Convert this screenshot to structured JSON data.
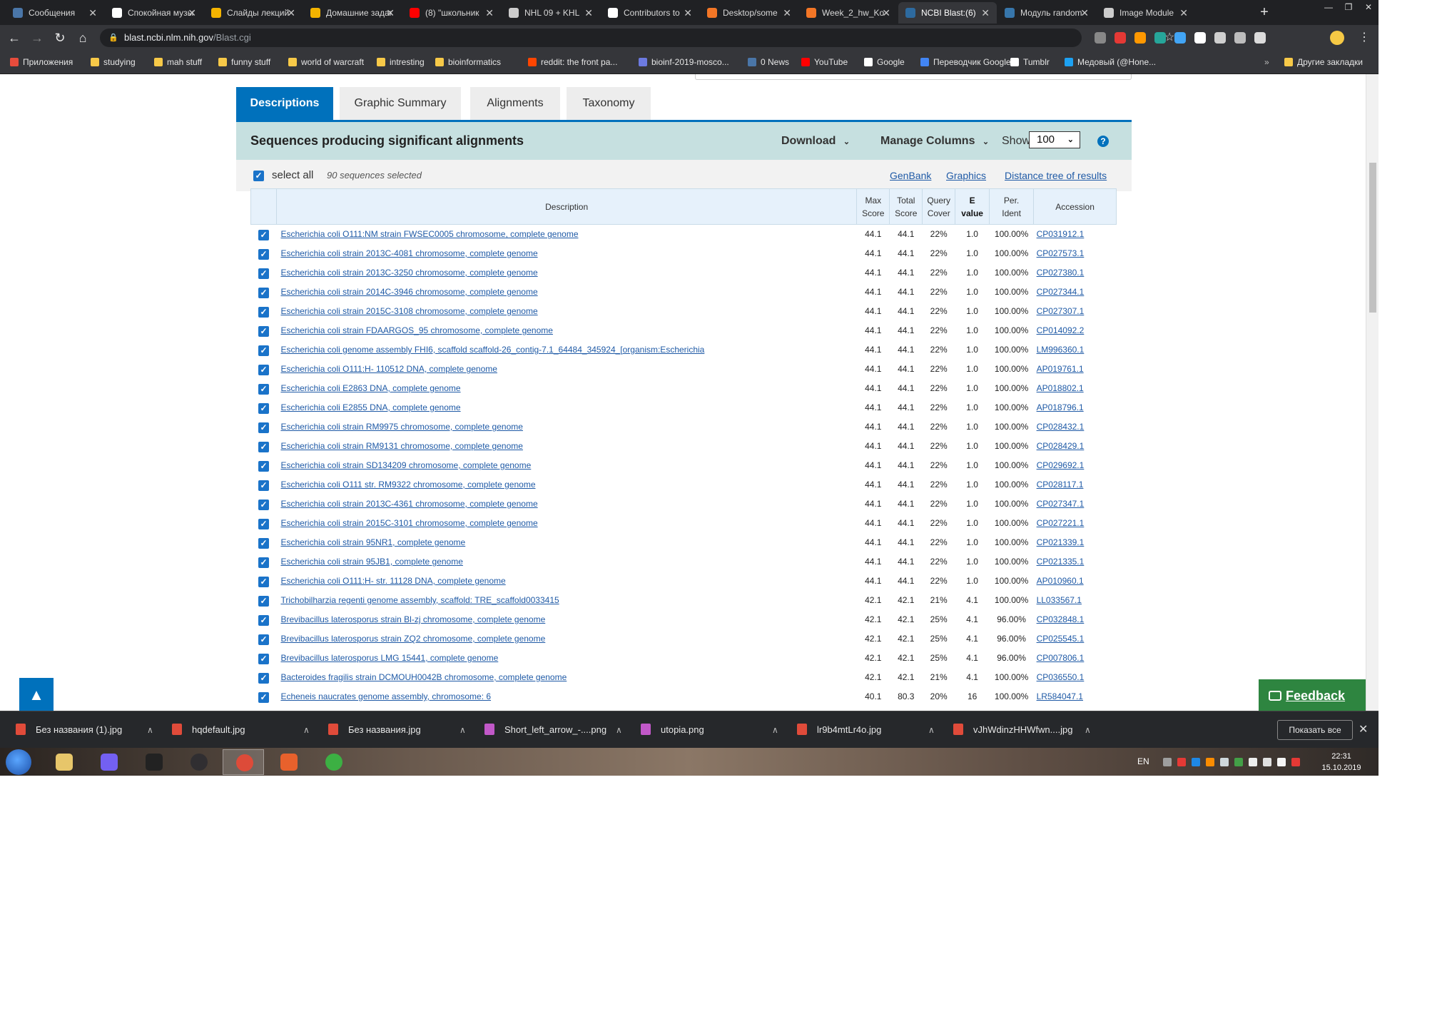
{
  "browser": {
    "tabs": [
      {
        "title": "Сообщения",
        "color": "#4a76a8"
      },
      {
        "title": "Спокойная музыка",
        "color": "#ffffff"
      },
      {
        "title": "Слайды лекций",
        "color": "#f4b400"
      },
      {
        "title": "Домашние задания",
        "color": "#f4b400"
      },
      {
        "title": "(8) \"школьник",
        "color": "#ff0000"
      },
      {
        "title": "NHL 09 + KHL",
        "color": "#cccccc"
      },
      {
        "title": "Contributors to",
        "color": "#ffffff"
      },
      {
        "title": "Desktop/some",
        "color": "#f37626"
      },
      {
        "title": "Week_2_hw_Ko",
        "color": "#f37626"
      },
      {
        "title": "NCBI Blast:(6)",
        "color": "#2d6a9f"
      },
      {
        "title": "Модуль random",
        "color": "#3776ab"
      },
      {
        "title": "Image Module",
        "color": "#cccccc"
      }
    ],
    "active_tab_index": 9,
    "url_host": "blast.ncbi.nlm.nih.gov",
    "url_path": "/Blast.cgi",
    "bookmarks": [
      {
        "label": "Приложения",
        "color": "#e74c3c"
      },
      {
        "label": "studying",
        "color": "#f7c948"
      },
      {
        "label": "mah stuff",
        "color": "#f7c948"
      },
      {
        "label": "funny stuff",
        "color": "#f7c948"
      },
      {
        "label": "world of warcraft",
        "color": "#f7c948"
      },
      {
        "label": "intresting",
        "color": "#f7c948"
      },
      {
        "label": "bioinformatics",
        "color": "#f7c948"
      },
      {
        "label": "reddit: the front pa...",
        "color": "#ff4500"
      },
      {
        "label": "bioinf-2019-mosco...",
        "color": "#6c7ae0"
      },
      {
        "label": "0 News",
        "color": "#4a76a8"
      },
      {
        "label": "YouTube",
        "color": "#ff0000"
      },
      {
        "label": "Google",
        "color": "#ffffff"
      },
      {
        "label": "Переводчик Google",
        "color": "#4285f4"
      },
      {
        "label": "Tumblr",
        "color": "#ffffff"
      },
      {
        "label": "Медовый (@Hone...",
        "color": "#1da1f2"
      }
    ],
    "other_bookmarks": "Другие закладки"
  },
  "blast": {
    "tabs": [
      "Descriptions",
      "Graphic Summary",
      "Alignments",
      "Taxonomy"
    ],
    "active_tab": "Descriptions",
    "header_title": "Sequences producing significant alignments",
    "download_label": "Download",
    "manage_columns_label": "Manage Columns",
    "show_label": "Show",
    "show_value": "100",
    "help_glyph": "?",
    "select_all_label": "select all",
    "selected_count": "90 sequences selected",
    "links": [
      "GenBank",
      "Graphics",
      "Distance tree of results"
    ],
    "columns": {
      "description": "Description",
      "max_score": [
        "Max",
        "Score"
      ],
      "total_score": [
        "Total",
        "Score"
      ],
      "query_cover": [
        "Query",
        "Cover"
      ],
      "e_value": [
        "E",
        "value"
      ],
      "per_ident": [
        "Per.",
        "Ident"
      ],
      "accession": "Accession"
    },
    "rows": [
      {
        "desc": "Escherichia coli O111:NM strain FWSEC0005 chromosome, complete genome",
        "max": "44.1",
        "total": "44.1",
        "cover": "22%",
        "e": "1.0",
        "ident": "100.00%",
        "acc": "CP031912.1"
      },
      {
        "desc": "Escherichia coli strain 2013C-4081 chromosome, complete genome",
        "max": "44.1",
        "total": "44.1",
        "cover": "22%",
        "e": "1.0",
        "ident": "100.00%",
        "acc": "CP027573.1"
      },
      {
        "desc": "Escherichia coli strain 2013C-3250 chromosome, complete genome",
        "max": "44.1",
        "total": "44.1",
        "cover": "22%",
        "e": "1.0",
        "ident": "100.00%",
        "acc": "CP027380.1"
      },
      {
        "desc": "Escherichia coli strain 2014C-3946 chromosome, complete genome",
        "max": "44.1",
        "total": "44.1",
        "cover": "22%",
        "e": "1.0",
        "ident": "100.00%",
        "acc": "CP027344.1"
      },
      {
        "desc": "Escherichia coli strain 2015C-3108 chromosome, complete genome",
        "max": "44.1",
        "total": "44.1",
        "cover": "22%",
        "e": "1.0",
        "ident": "100.00%",
        "acc": "CP027307.1"
      },
      {
        "desc": "Escherichia coli strain FDAARGOS_95 chromosome, complete genome",
        "max": "44.1",
        "total": "44.1",
        "cover": "22%",
        "e": "1.0",
        "ident": "100.00%",
        "acc": "CP014092.2"
      },
      {
        "desc": "Escherichia coli genome assembly FHI6, scaffold scaffold-26_contig-7.1_64484_345924_[organism:Escherichia",
        "max": "44.1",
        "total": "44.1",
        "cover": "22%",
        "e": "1.0",
        "ident": "100.00%",
        "acc": "LM996360.1"
      },
      {
        "desc": "Escherichia coli O111:H- 110512 DNA, complete genome",
        "max": "44.1",
        "total": "44.1",
        "cover": "22%",
        "e": "1.0",
        "ident": "100.00%",
        "acc": "AP019761.1"
      },
      {
        "desc": "Escherichia coli E2863 DNA, complete genome",
        "max": "44.1",
        "total": "44.1",
        "cover": "22%",
        "e": "1.0",
        "ident": "100.00%",
        "acc": "AP018802.1"
      },
      {
        "desc": "Escherichia coli E2855 DNA, complete genome",
        "max": "44.1",
        "total": "44.1",
        "cover": "22%",
        "e": "1.0",
        "ident": "100.00%",
        "acc": "AP018796.1"
      },
      {
        "desc": "Escherichia coli strain RM9975 chromosome, complete genome",
        "max": "44.1",
        "total": "44.1",
        "cover": "22%",
        "e": "1.0",
        "ident": "100.00%",
        "acc": "CP028432.1"
      },
      {
        "desc": "Escherichia coli strain RM9131 chromosome, complete genome",
        "max": "44.1",
        "total": "44.1",
        "cover": "22%",
        "e": "1.0",
        "ident": "100.00%",
        "acc": "CP028429.1"
      },
      {
        "desc": "Escherichia coli strain SD134209 chromosome, complete genome",
        "max": "44.1",
        "total": "44.1",
        "cover": "22%",
        "e": "1.0",
        "ident": "100.00%",
        "acc": "CP029692.1"
      },
      {
        "desc": "Escherichia coli O111 str. RM9322 chromosome, complete genome",
        "max": "44.1",
        "total": "44.1",
        "cover": "22%",
        "e": "1.0",
        "ident": "100.00%",
        "acc": "CP028117.1"
      },
      {
        "desc": "Escherichia coli strain 2013C-4361 chromosome, complete genome",
        "max": "44.1",
        "total": "44.1",
        "cover": "22%",
        "e": "1.0",
        "ident": "100.00%",
        "acc": "CP027347.1"
      },
      {
        "desc": "Escherichia coli strain 2015C-3101 chromosome, complete genome",
        "max": "44.1",
        "total": "44.1",
        "cover": "22%",
        "e": "1.0",
        "ident": "100.00%",
        "acc": "CP027221.1"
      },
      {
        "desc": "Escherichia coli strain 95NR1, complete genome",
        "max": "44.1",
        "total": "44.1",
        "cover": "22%",
        "e": "1.0",
        "ident": "100.00%",
        "acc": "CP021339.1"
      },
      {
        "desc": "Escherichia coli strain 95JB1, complete genome",
        "max": "44.1",
        "total": "44.1",
        "cover": "22%",
        "e": "1.0",
        "ident": "100.00%",
        "acc": "CP021335.1"
      },
      {
        "desc": "Escherichia coli O111:H- str. 11128 DNA, complete genome",
        "max": "44.1",
        "total": "44.1",
        "cover": "22%",
        "e": "1.0",
        "ident": "100.00%",
        "acc": "AP010960.1"
      },
      {
        "desc": "Trichobilharzia regenti genome assembly, scaffold: TRE_scaffold0033415",
        "max": "42.1",
        "total": "42.1",
        "cover": "21%",
        "e": "4.1",
        "ident": "100.00%",
        "acc": "LL033567.1"
      },
      {
        "desc": "Brevibacillus laterosporus strain Bl-zj chromosome, complete genome",
        "max": "42.1",
        "total": "42.1",
        "cover": "25%",
        "e": "4.1",
        "ident": "96.00%",
        "acc": "CP032848.1"
      },
      {
        "desc": "Brevibacillus laterosporus strain ZQ2 chromosome, complete genome",
        "max": "42.1",
        "total": "42.1",
        "cover": "25%",
        "e": "4.1",
        "ident": "96.00%",
        "acc": "CP025545.1"
      },
      {
        "desc": "Brevibacillus laterosporus LMG 15441, complete genome",
        "max": "42.1",
        "total": "42.1",
        "cover": "25%",
        "e": "4.1",
        "ident": "96.00%",
        "acc": "CP007806.1"
      },
      {
        "desc": "Bacteroides fragilis strain DCMOUH0042B chromosome, complete genome",
        "max": "42.1",
        "total": "42.1",
        "cover": "21%",
        "e": "4.1",
        "ident": "100.00%",
        "acc": "CP036550.1"
      },
      {
        "desc": "Echeneis naucrates genome assembly, chromosome: 6",
        "max": "40.1",
        "total": "80.3",
        "cover": "20%",
        "e": "16",
        "ident": "100.00%",
        "acc": "LR584047.1"
      }
    ],
    "feedback_label": "Feedback"
  },
  "downloads": {
    "items": [
      {
        "name": "Без названия (1).jpg",
        "type": "jpg"
      },
      {
        "name": "hqdefault.jpg",
        "type": "jpg"
      },
      {
        "name": "Без названия.jpg",
        "type": "jpg"
      },
      {
        "name": "Short_left_arrow_-....png",
        "type": "png"
      },
      {
        "name": "utopia.png",
        "type": "png"
      },
      {
        "name": "lr9b4mtLr4o.jpg",
        "type": "jpg"
      },
      {
        "name": "vJhWdinzHHWfwn....jpg",
        "type": "jpg"
      }
    ],
    "show_all_label": "Показать все"
  },
  "taskbar": {
    "apps": [
      {
        "name": "explorer",
        "color": "#e7c66a"
      },
      {
        "name": "viber",
        "color": "#7360f2"
      },
      {
        "name": "media-player",
        "color": "#222222"
      },
      {
        "name": "obs",
        "color": "#302e31"
      },
      {
        "name": "chrome",
        "color": "#dd4b39"
      },
      {
        "name": "app-orange",
        "color": "#e8612c"
      },
      {
        "name": "app-green",
        "color": "#3cb043"
      }
    ],
    "active_app_index": 4,
    "language": "EN",
    "time": "22:31",
    "date": "15.10.2019"
  }
}
